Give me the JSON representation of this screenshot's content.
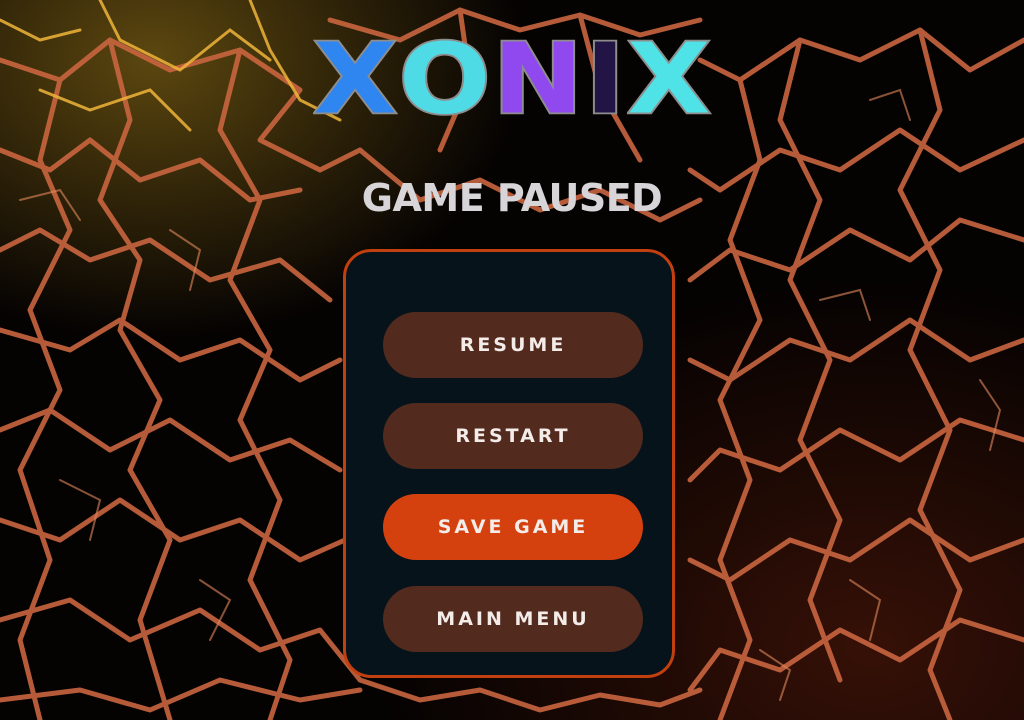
{
  "logo": {
    "letters": [
      {
        "char": "X",
        "color": "#2f86f0"
      },
      {
        "char": "O",
        "color": "#4fdbe5"
      },
      {
        "char": "N",
        "color": "#8f49ef"
      },
      {
        "char": "I",
        "color": "#221545"
      },
      {
        "char": "X",
        "color": "#4fe2e6"
      }
    ],
    "outline_color": "#8d8d8d"
  },
  "title": "GAME PAUSED",
  "menu": {
    "resume_label": "RESUME",
    "restart_label": "RESTART",
    "save_label": "SAVE GAME",
    "main_menu_label": "MAIN MENU",
    "selected": "SAVE GAME"
  },
  "colors": {
    "panel_bg": "#07131b",
    "panel_border": "#c2400f",
    "button_bg": "#522a1e",
    "button_active_bg": "#d5410e",
    "button_text": "#f4ece8",
    "title_text": "#d7d5d8",
    "lava_crack": "#d9744a",
    "lava_glow": "#f5c23a"
  }
}
